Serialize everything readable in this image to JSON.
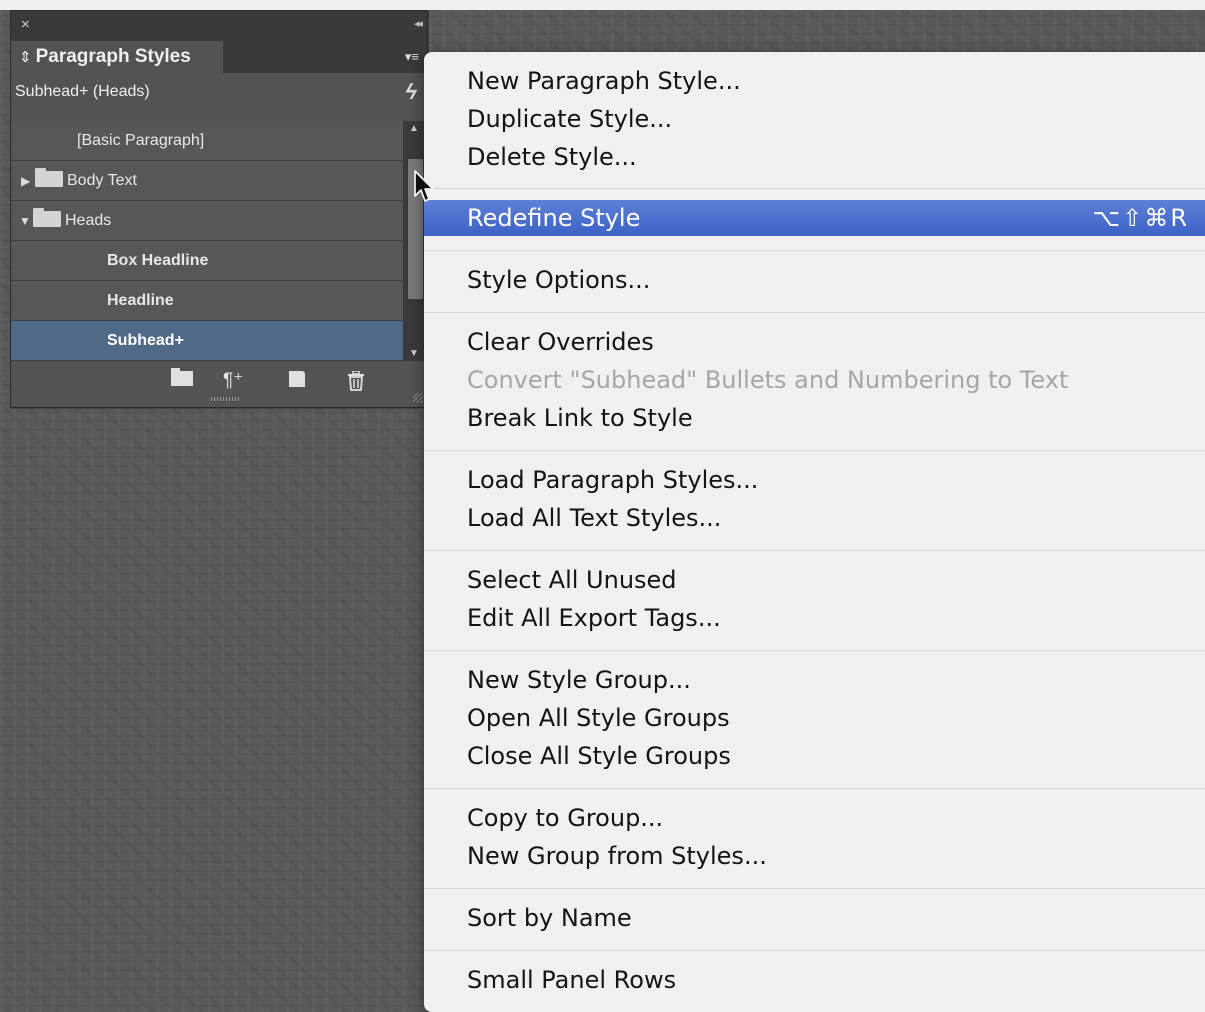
{
  "panel": {
    "close_icon": "×",
    "collapse_icon": "◂◂",
    "tab_title": "Paragraph Styles",
    "tab_arrows_icon": "⇕",
    "menu_button_icon": "▾≡",
    "current_style": "Subhead+ (Heads)",
    "quick_apply_icon": "ϟ",
    "styles": [
      {
        "label": "[Basic Paragraph]",
        "type": "style"
      },
      {
        "label": "Body Text",
        "type": "group",
        "expanded": false
      },
      {
        "label": "Heads",
        "type": "group",
        "expanded": true
      },
      {
        "label": "Box Headline",
        "type": "style"
      },
      {
        "label": "Headline",
        "type": "style"
      },
      {
        "label": "Subhead+",
        "type": "style",
        "selected": true
      }
    ],
    "footer_icons": [
      "new-style-group-icon",
      "clear-overrides-icon",
      "create-new-style-icon",
      "delete-style-icon"
    ],
    "clear_overrides_glyph": "¶⁺",
    "delete_glyph": "🗑"
  },
  "menu": {
    "items": {
      "new_paragraph_style": "New Paragraph Style...",
      "duplicate_style": "Duplicate Style...",
      "delete_style": "Delete Style...",
      "redefine_style": "Redefine Style",
      "redefine_shortcut": "⌥⇧⌘R",
      "style_options": "Style Options...",
      "clear_overrides": "Clear Overrides",
      "convert_bullets": "Convert \"Subhead\" Bullets and Numbering to Text",
      "break_link": "Break Link to Style",
      "load_paragraph_styles": "Load Paragraph Styles...",
      "load_all_text_styles": "Load All Text Styles...",
      "select_all_unused": "Select All Unused",
      "edit_all_export_tags": "Edit All Export Tags...",
      "new_style_group": "New Style Group...",
      "open_all_style_groups": "Open All Style Groups",
      "close_all_style_groups": "Close All Style Groups",
      "copy_to_group": "Copy to Group...",
      "new_group_from_styles": "New Group from Styles...",
      "sort_by_name": "Sort by Name",
      "small_panel_rows": "Small Panel Rows"
    },
    "highlighted_item": "Redefine Style",
    "disabled_items": [
      "Convert \"Subhead\" Bullets and Numbering to Text"
    ]
  },
  "colors": {
    "panel_bg": "#535353",
    "selected_row": "#4f6987",
    "menu_bg": "#f0f0f0",
    "menu_highlight": "#4a6fcf",
    "disabled_text": "#a6a6a6"
  }
}
